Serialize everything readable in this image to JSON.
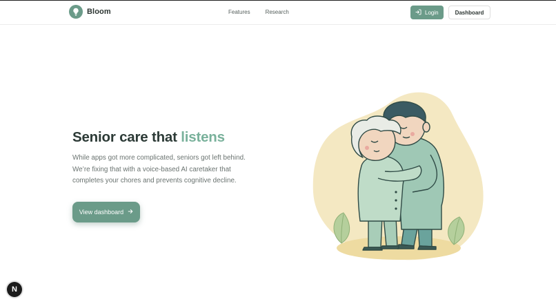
{
  "header": {
    "brand_name": "Bloom",
    "logo_icon": "lightbulb-icon",
    "nav_links": [
      "Features",
      "Research"
    ],
    "login_label": "Login",
    "login_icon": "login-arrow-icon",
    "dashboard_label": "Dashboard"
  },
  "hero": {
    "title_prefix": "Senior care that ",
    "title_accent": "listens",
    "body_lines": [
      "While apps got more complicated, seniors got left behind.",
      "We’re fixing that with a voice-based AI caretaker that",
      "completes your chores and prevents cognitive decline."
    ],
    "cta_label": "View dashboard",
    "cta_icon": "arrow-right-icon",
    "illustration": "elderly-couple-hugging-illustration"
  },
  "dev_badge": {
    "label": "N"
  },
  "colors": {
    "brand": "#6b9b89",
    "accent_text": "#79b19b",
    "blob": "#f4e8c2",
    "heading": "#2c3a36",
    "body_text": "#6a7370"
  }
}
